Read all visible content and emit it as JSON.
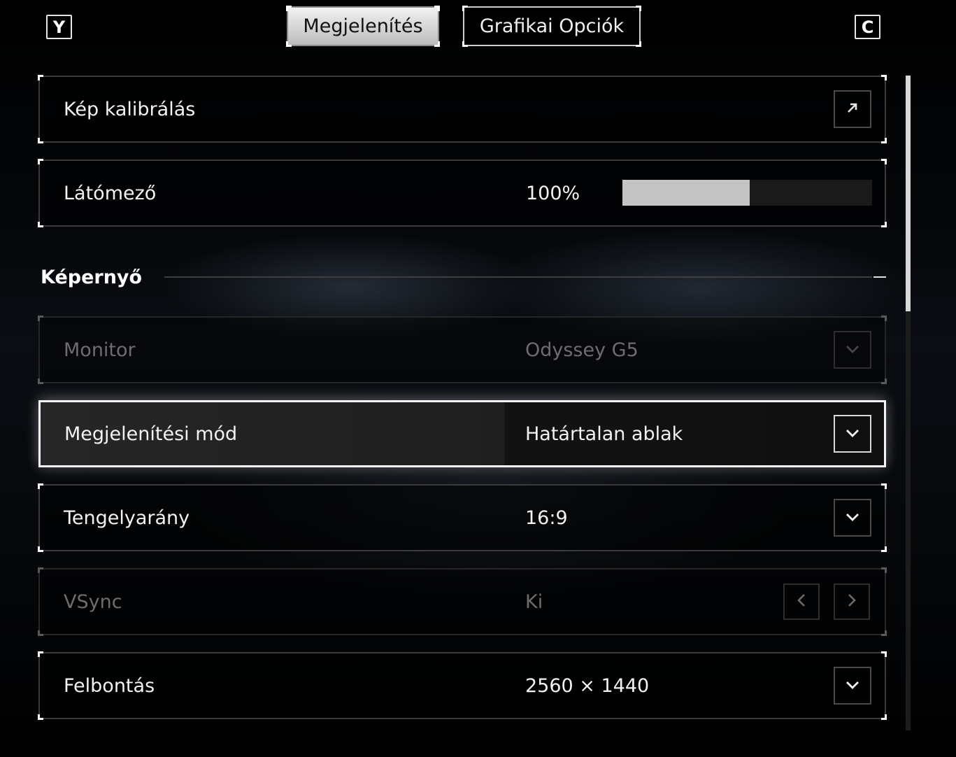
{
  "topbar": {
    "left_key": "Y",
    "right_key": "C",
    "tabs": [
      {
        "label": "Megjelenítés",
        "active": true
      },
      {
        "label": "Grafikai Opciók",
        "active": false
      }
    ]
  },
  "rows_top": {
    "calibration": {
      "label": "Kép kalibrálás",
      "icon": "external-link-arrow-icon"
    },
    "fov": {
      "label": "Látómező",
      "value": "100%",
      "slider_fraction": 0.51
    }
  },
  "section": {
    "title": "Képernyő",
    "icon": "collapse-minus-icon"
  },
  "settings": {
    "monitor": {
      "label": "Monitor",
      "value": "Odyssey G5",
      "disabled": true
    },
    "display_mode": {
      "label": "Megjelenítési mód",
      "value": "Határtalan ablak",
      "focused": true
    },
    "aspect_ratio": {
      "label": "Tengelyarány",
      "value": "16:9"
    },
    "vsync": {
      "label": "VSync",
      "value": "Ki",
      "disabled": true
    },
    "resolution": {
      "label": "Felbontás",
      "value": "2560 × 1440"
    }
  },
  "scrollbar": {
    "thumb_fraction": 0.36
  },
  "colors": {
    "accent": "#ffffff",
    "background": "#000000",
    "disabled_text": "#6d6d6d",
    "slider_fill": "#c4c4c4"
  }
}
